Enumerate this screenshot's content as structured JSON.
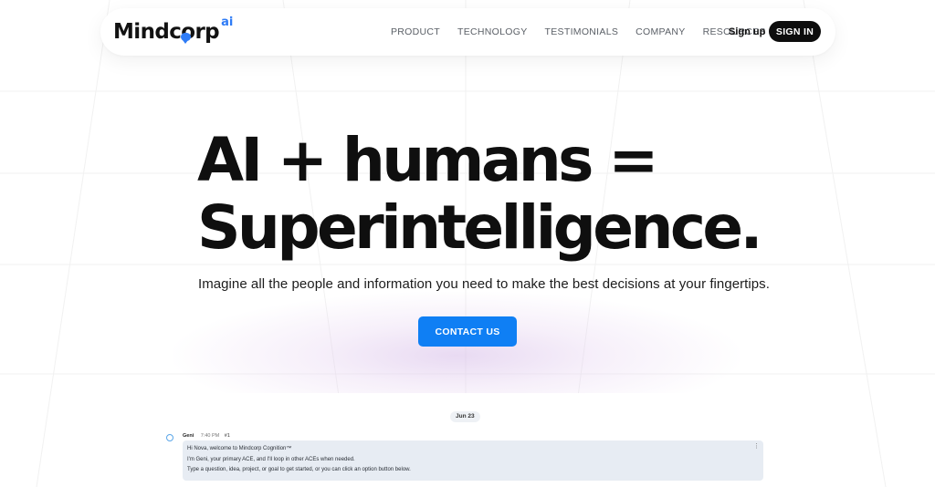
{
  "brand": {
    "name": "Mindcorp",
    "suffix": "ai",
    "accent_color": "#2f7cf6"
  },
  "nav": {
    "items": [
      {
        "label": "PRODUCT"
      },
      {
        "label": "TECHNOLOGY"
      },
      {
        "label": "TESTIMONIALS"
      },
      {
        "label": "COMPANY"
      },
      {
        "label": "RESOURCES"
      }
    ],
    "signup_label": "Sign up",
    "signin_label": "SIGN IN"
  },
  "hero": {
    "headline_line1": "AI + humans =",
    "headline_line2": "Superintelligence.",
    "subtitle": "Imagine all the people and information you need to make the best decisions at your fingertips.",
    "cta_label": "CONTACT US",
    "cta_color": "#0f7ff4"
  },
  "chat_preview": {
    "date": "Jun 23",
    "sender": "Geni",
    "time": "7:40 PM",
    "message_number": "#1",
    "menu_icon": "more-vertical-icon",
    "lines": [
      "Hi Nova, welcome to Mindcorp Cognition™",
      "I'm Geni, your primary ACE, and I'll loop in other ACEs when needed.",
      "Type a question, idea, project, or goal to get started, or you can click an option button below."
    ]
  }
}
